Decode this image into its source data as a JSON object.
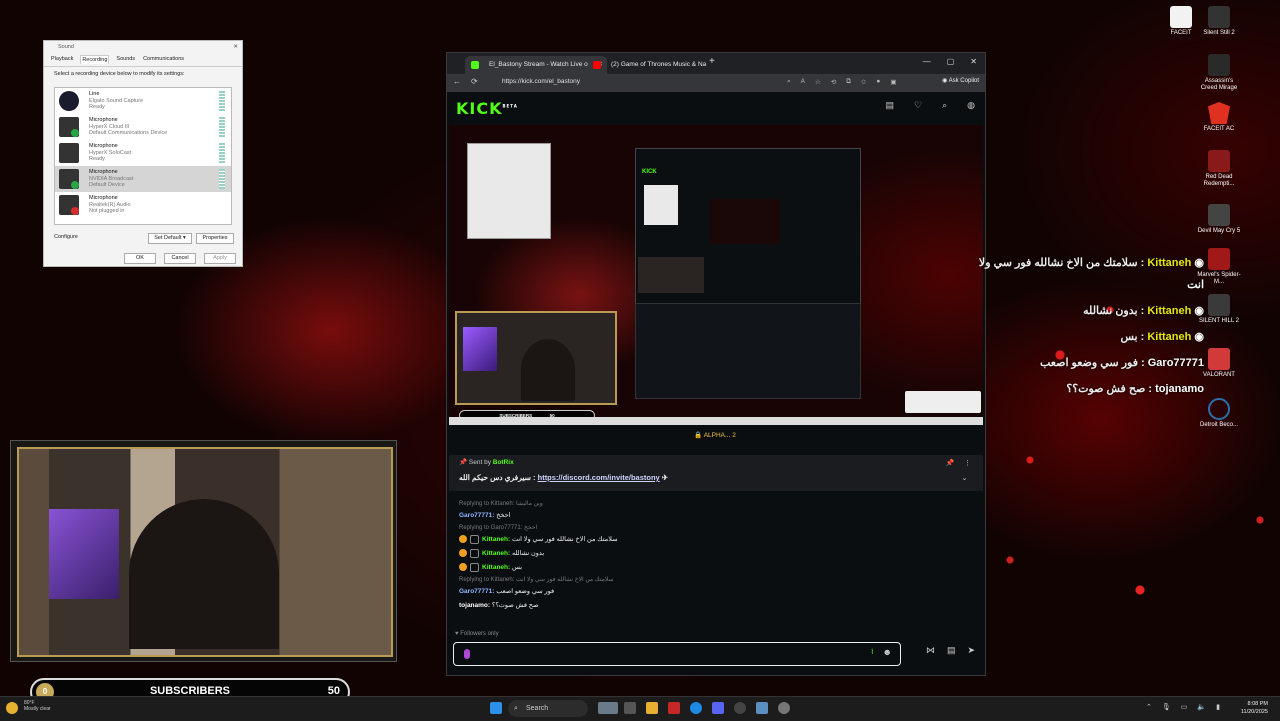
{
  "desktop": {
    "icons": [
      {
        "label": "FACEIT",
        "color": "#f2f2f2"
      },
      {
        "label": "Silent Still 2",
        "color": "#333333"
      },
      {
        "label": "Assassin's Creed Mirage",
        "color": "#2a2a2a"
      },
      {
        "label": "FACEIT AC",
        "color": "#e03020"
      },
      {
        "label": "Red Dead Redempti...",
        "color": "#8a1a1a"
      },
      {
        "label": "Devil May Cry 5",
        "color": "#444444"
      },
      {
        "label": "Marvel's Spider-M...",
        "color": "#a01818"
      },
      {
        "label": "SILENT HILL 2",
        "color": "#3a3a3a"
      },
      {
        "label": "VALORANT",
        "color": "#d23a3a"
      },
      {
        "label": "Detroit Beco...",
        "color": "#2b6fa8"
      }
    ]
  },
  "sound_dialog": {
    "title": "Sound",
    "tabs": [
      "Playback",
      "Recording",
      "Sounds",
      "Communications"
    ],
    "hint": "Select a recording device below to modify its settings:",
    "devices": [
      {
        "name": "Line",
        "sub": "Elgato Sound Capture",
        "status": "Ready"
      },
      {
        "name": "Microphone",
        "sub": "HyperX Cloud III",
        "status": "Default Communications Device"
      },
      {
        "name": "Microphone",
        "sub": "HyperX SoloCast",
        "status": "Ready"
      },
      {
        "name": "Microphone",
        "sub": "NVIDIA Broadcast",
        "status": "Default Device"
      },
      {
        "name": "Microphone",
        "sub": "Realtek(R) Audio",
        "status": "Not plugged in"
      }
    ],
    "configure": "Configure",
    "set_default": "Set Default",
    "properties": "Properties",
    "ok": "OK",
    "cancel": "Cancel",
    "apply": "Apply"
  },
  "browser": {
    "tabs": [
      {
        "title": "El_Bastony Stream - Watch Live o",
        "color": "#53fc18"
      },
      {
        "title": "(2) Game of Thrones Music & Na",
        "color": "#ff0000"
      }
    ],
    "url": "https://kick.com/el_bastony",
    "copilot": "Ask Copilot",
    "new_tab": "+",
    "win_controls": [
      "—",
      "▢",
      "✕"
    ]
  },
  "kick": {
    "logo": "KICK",
    "logo_sup": "BETA",
    "raid_banner": "ALPHA... 2",
    "video_subs_label": "SUBSCRIBERS",
    "video_subs_count": "50",
    "pinned": {
      "sent_by": "Sent by",
      "bot": "BotRix",
      "text_prefix": "سيرفري دس حيكم الله : ",
      "link": "https://discord.com/invite/bastony"
    },
    "messages": [
      {
        "reply": "Replying to Kittaneh: وين ماليشا",
        "user": "Garo77771",
        "utype": "b",
        "text": "احخخ"
      },
      {
        "reply": "Replying to Garo77771: احخخ",
        "user": "",
        "utype": "",
        "text": ""
      },
      {
        "reply": "",
        "user": "Kittaneh",
        "utype": "g",
        "text": "سلامتك من الاخ نشالله فور سي ولا انت"
      },
      {
        "reply": "",
        "user": "Kittaneh",
        "utype": "g",
        "text": "بدون نشالله"
      },
      {
        "reply": "",
        "user": "Kittaneh",
        "utype": "g",
        "text": "بس"
      },
      {
        "reply": "Replying to Kittaneh: سلامتك من الاخ نشالله فور سي ولا انت",
        "user": "Garo77771",
        "utype": "b",
        "text": "فور سي وضعو اصعب"
      },
      {
        "reply": "",
        "user": "tojanamo",
        "utype": "w",
        "text": "صح فش صوت؟؟"
      }
    ],
    "followers_only": "Followers only"
  },
  "overlay_chat": [
    {
      "user": "Kittaneh",
      "text": "سلامتك من الاخ نشالله فور سي ولا",
      "cont": "انت"
    },
    {
      "user": "Kittaneh",
      "text": "بدون نشالله",
      "cont": ""
    },
    {
      "user": "Kittaneh",
      "text": "بس",
      "cont": ""
    },
    {
      "user": "Garo77771",
      "text": "فور سي وضعو اصعب",
      "cont": ""
    },
    {
      "user": "tojanamo",
      "text": "صح فش صوت؟؟",
      "cont": ""
    }
  ],
  "subs_bar": {
    "count": "0",
    "label": "SUBSCRIBERS",
    "goal": "50"
  },
  "taskbar": {
    "weather_temp": "80°F",
    "weather_desc": "Mostly clear",
    "search": "Search",
    "time": "8:08 PM",
    "date": "11/20/2025"
  }
}
